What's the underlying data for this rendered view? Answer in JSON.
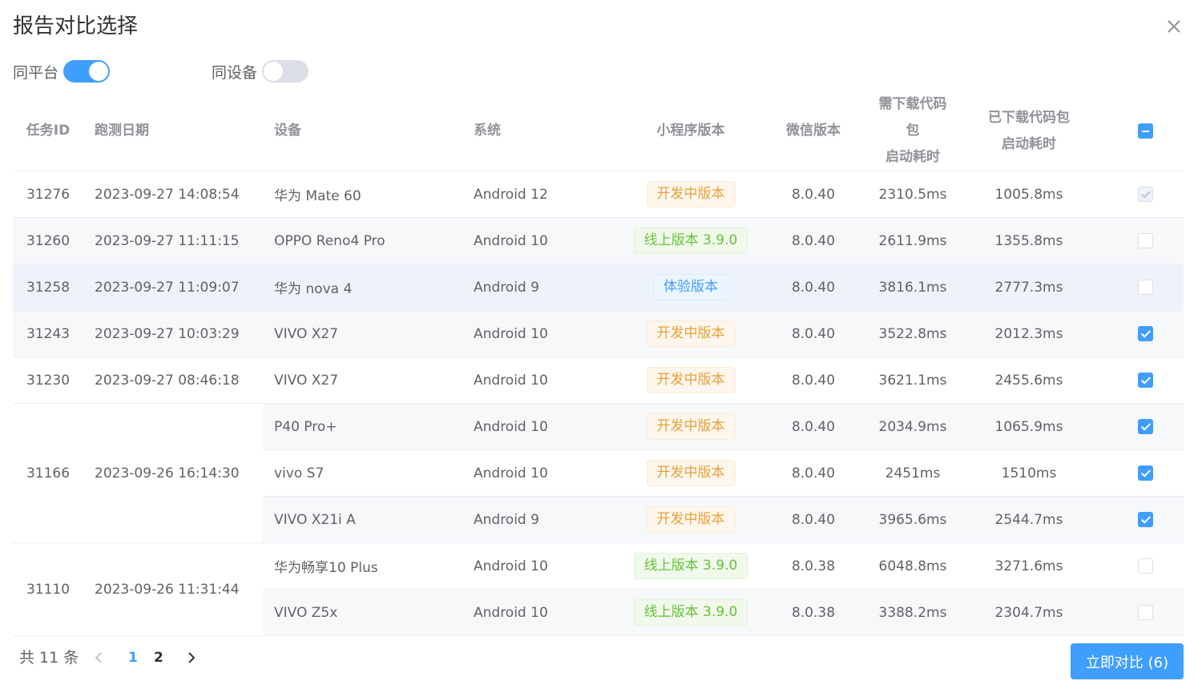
{
  "dialog": {
    "title": "报告对比选择"
  },
  "filters": {
    "same_platform": {
      "label": "同平台",
      "on": true
    },
    "same_device": {
      "label": "同设备",
      "on": false
    }
  },
  "table": {
    "headers": {
      "task_id": "任务ID",
      "run_date": "跑测日期",
      "device": "设备",
      "system": "系统",
      "miniprogram_version": "小程序版本",
      "wechat_version": "微信版本",
      "need_download_line1": "需下载代码包",
      "need_download_line2": "启动耗时",
      "downloaded_line1": "已下载代码包",
      "downloaded_line2": "启动耗时"
    },
    "header_checkbox_state": "indeterminate",
    "groups": [
      {
        "task_id": "31276",
        "date": "2023-09-27 14:08:54",
        "rows": [
          {
            "device": "华为 Mate 60",
            "system": "Android 12",
            "version": "开发中版本",
            "tag": "orange",
            "wechat": "8.0.40",
            "need": "2310.5ms",
            "done": "1005.8ms",
            "checkbox": "disabled"
          }
        ]
      },
      {
        "task_id": "31260",
        "date": "2023-09-27 11:11:15",
        "rows": [
          {
            "device": "OPPO Reno4 Pro",
            "system": "Android 10",
            "version": "线上版本 3.9.0",
            "tag": "green",
            "wechat": "8.0.40",
            "need": "2611.9ms",
            "done": "1355.8ms",
            "checkbox": "unchecked"
          }
        ]
      },
      {
        "task_id": "31258",
        "date": "2023-09-27 11:09:07",
        "rows": [
          {
            "device": "华为 nova 4",
            "system": "Android 9",
            "version": "体验版本",
            "tag": "blue",
            "wechat": "8.0.40",
            "need": "3816.1ms",
            "done": "2777.3ms",
            "checkbox": "unchecked"
          }
        ]
      },
      {
        "task_id": "31243",
        "date": "2023-09-27 10:03:29",
        "rows": [
          {
            "device": "VIVO X27",
            "system": "Android 10",
            "version": "开发中版本",
            "tag": "orange",
            "wechat": "8.0.40",
            "need": "3522.8ms",
            "done": "2012.3ms",
            "checkbox": "checked"
          }
        ]
      },
      {
        "task_id": "31230",
        "date": "2023-09-27 08:46:18",
        "rows": [
          {
            "device": "VIVO X27",
            "system": "Android 10",
            "version": "开发中版本",
            "tag": "orange",
            "wechat": "8.0.40",
            "need": "3621.1ms",
            "done": "2455.6ms",
            "checkbox": "checked"
          }
        ]
      },
      {
        "task_id": "31166",
        "date": "2023-09-26 16:14:30",
        "rows": [
          {
            "device": "P40 Pro+",
            "system": "Android 10",
            "version": "开发中版本",
            "tag": "orange",
            "wechat": "8.0.40",
            "need": "2034.9ms",
            "done": "1065.9ms",
            "checkbox": "checked"
          },
          {
            "device": "vivo S7",
            "system": "Android 10",
            "version": "开发中版本",
            "tag": "orange",
            "wechat": "8.0.40",
            "need": "2451ms",
            "done": "1510ms",
            "checkbox": "checked"
          },
          {
            "device": "VIVO X21i A",
            "system": "Android 9",
            "version": "开发中版本",
            "tag": "orange",
            "wechat": "8.0.40",
            "need": "3965.6ms",
            "done": "2544.7ms",
            "checkbox": "checked"
          }
        ]
      },
      {
        "task_id": "31110",
        "date": "2023-09-26 11:31:44",
        "rows": [
          {
            "device": "华为畅享10 Plus",
            "system": "Android 10",
            "version": "线上版本 3.9.0",
            "tag": "green",
            "wechat": "8.0.38",
            "need": "6048.8ms",
            "done": "3271.6ms",
            "checkbox": "unchecked"
          },
          {
            "device": "VIVO Z5x",
            "system": "Android 10",
            "version": "线上版本 3.9.0",
            "tag": "green",
            "wechat": "8.0.38",
            "need": "3388.2ms",
            "done": "2304.7ms",
            "checkbox": "unchecked"
          }
        ]
      }
    ]
  },
  "footer": {
    "total": "共 11 条",
    "pages": [
      "1",
      "2"
    ],
    "current_page": "1",
    "compare_button": "立即对比 (6)"
  },
  "colors": {
    "primary": "#409eff",
    "tag_orange": "#e6a23c",
    "tag_green": "#67c23a",
    "tag_blue": "#409eff"
  }
}
